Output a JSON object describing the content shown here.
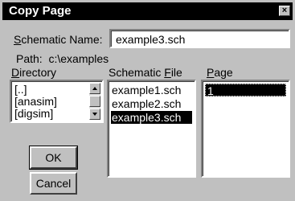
{
  "window": {
    "title": "Copy Page",
    "close_symbol": "×"
  },
  "schematic_name": {
    "label_prefix": "S",
    "label_rest": "chematic Name:",
    "value": "example3.sch"
  },
  "path": {
    "label": "Path:",
    "value": "c:\\examples"
  },
  "directory": {
    "label_prefix": "D",
    "label_rest": "irectory",
    "items": [
      "[..]",
      "[anasim]",
      "[digsim]"
    ]
  },
  "schematic_file": {
    "label_prefix": "Schematic ",
    "label_u": "F",
    "label_rest": "ile",
    "items": [
      "example1.sch",
      "example2.sch",
      "example3.sch"
    ],
    "selected_index": 2
  },
  "page": {
    "label_prefix": "P",
    "label_rest": "age",
    "items": [
      "1"
    ]
  },
  "buttons": {
    "ok": "OK",
    "cancel": "Cancel"
  }
}
